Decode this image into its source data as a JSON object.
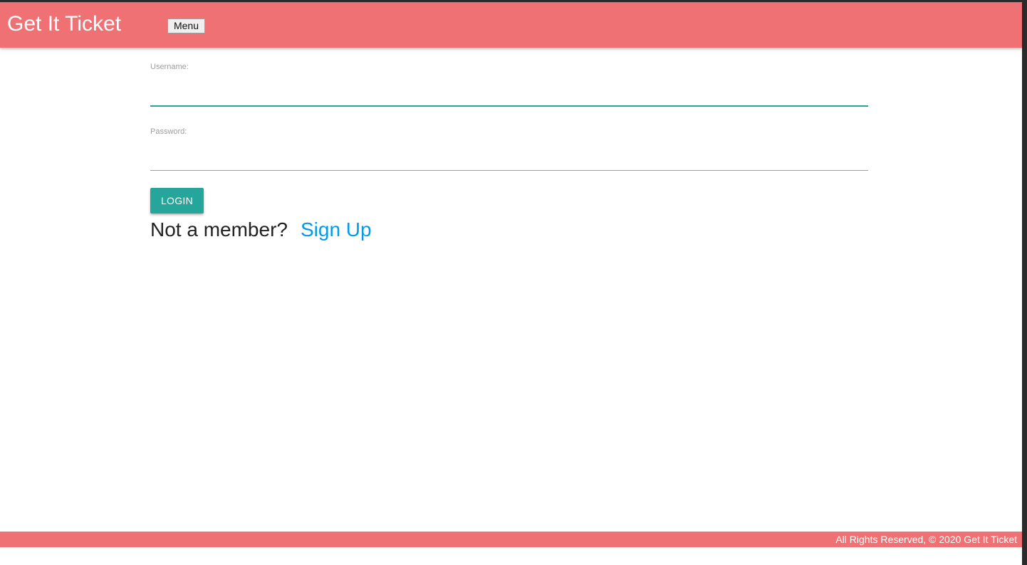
{
  "header": {
    "brand": "Get It Ticket",
    "menu_label": "Menu",
    "background_color": "#f07174"
  },
  "login_form": {
    "username_label": "Username:",
    "username_value": "",
    "password_label": "Password:",
    "password_value": "",
    "login_button": "LOGIN",
    "accent_color": "#26a69a"
  },
  "signup_prompt": {
    "text": "Not a member?",
    "link": "Sign Up",
    "link_color": "#039be5"
  },
  "footer": {
    "text": "All Rights Reserved, © 2020 Get It Ticket"
  }
}
